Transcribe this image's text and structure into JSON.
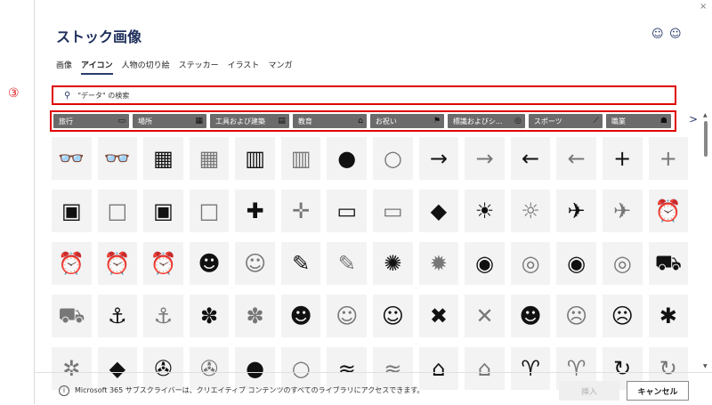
{
  "window": {
    "close_label": "×"
  },
  "header": {
    "title": "ストック画像",
    "smiley_1": "☺",
    "smiley_2": "☺"
  },
  "tabs": [
    "画像",
    "アイコン",
    "人物の切り絵",
    "ステッカー",
    "イラスト",
    "マンガ"
  ],
  "active_tab": "アイコン",
  "annotation_marker": "③",
  "search": {
    "text": "\"データ\" の検索",
    "icon": "search-icon"
  },
  "categories": [
    {
      "label": "旅行",
      "icon": "bus-icon"
    },
    {
      "label": "場所",
      "icon": "map-icon"
    },
    {
      "label": "工具および建築",
      "icon": "building-icon"
    },
    {
      "label": "教育",
      "icon": "school-icon"
    },
    {
      "label": "お祝い",
      "icon": "flag-icon"
    },
    {
      "label": "標識およびシ...",
      "icon": "sign-icon"
    },
    {
      "label": "スポーツ",
      "icon": "racket-icon"
    },
    {
      "label": "職業",
      "icon": "worker-icon"
    }
  ],
  "next_arrow": ">",
  "icon_grid": [
    [
      {
        "name": "3d-glasses",
        "glyph": "👓"
      },
      {
        "name": "3d-glasses-outline",
        "glyph": "👓"
      },
      {
        "name": "abacus",
        "glyph": "▦"
      },
      {
        "name": "abacus-outline",
        "glyph": "▦"
      },
      {
        "name": "abacus-alt",
        "glyph": "▥"
      },
      {
        "name": "abacus-alt-outline",
        "glyph": "▥"
      },
      {
        "name": "acorn",
        "glyph": "●"
      },
      {
        "name": "acorn-outline",
        "glyph": "○"
      },
      {
        "name": "arrow-right",
        "glyph": "→"
      },
      {
        "name": "arrow-right-outline",
        "glyph": "→"
      },
      {
        "name": "arrow-left",
        "glyph": "←"
      },
      {
        "name": "arrow-left-outline",
        "glyph": "←"
      },
      {
        "name": "plus",
        "glyph": "+"
      },
      {
        "name": "plus-outline",
        "glyph": "+"
      }
    ],
    [
      {
        "name": "address-book",
        "glyph": "▣"
      },
      {
        "name": "address-book-outline",
        "glyph": "□"
      },
      {
        "name": "address-book-alt",
        "glyph": "▣"
      },
      {
        "name": "address-book-alt-outline",
        "glyph": "□"
      },
      {
        "name": "bandage",
        "glyph": "✚"
      },
      {
        "name": "bandage-outline",
        "glyph": "✛"
      },
      {
        "name": "billboard",
        "glyph": "▭"
      },
      {
        "name": "billboard-outline",
        "glyph": "▭"
      },
      {
        "name": "africa",
        "glyph": "◆"
      },
      {
        "name": "agriculture",
        "glyph": "☀"
      },
      {
        "name": "agriculture-outline",
        "glyph": "☼"
      },
      {
        "name": "airplane",
        "glyph": "✈"
      },
      {
        "name": "airplane-outline",
        "glyph": "✈"
      },
      {
        "name": "alarm-clock",
        "glyph": "⏰"
      }
    ],
    [
      {
        "name": "alarm-clock-outline",
        "glyph": "⏰"
      },
      {
        "name": "alarm-ringing",
        "glyph": "⏰"
      },
      {
        "name": "alarm-ringing-outline",
        "glyph": "⏰"
      },
      {
        "name": "alien",
        "glyph": "☻"
      },
      {
        "name": "alien-outline",
        "glyph": "☺"
      },
      {
        "name": "needle",
        "glyph": "✎"
      },
      {
        "name": "needle-outline",
        "glyph": "✎"
      },
      {
        "name": "yarn",
        "glyph": "✺"
      },
      {
        "name": "yarn-outline",
        "glyph": "✹"
      },
      {
        "name": "tape-measure",
        "glyph": "◉"
      },
      {
        "name": "tape-measure-outline",
        "glyph": "◎"
      },
      {
        "name": "button",
        "glyph": "◉"
      },
      {
        "name": "button-outline",
        "glyph": "◎"
      },
      {
        "name": "ambulance",
        "glyph": "⛟"
      }
    ],
    [
      {
        "name": "ambulance-outline",
        "glyph": "⛟"
      },
      {
        "name": "anchor",
        "glyph": "⚓"
      },
      {
        "name": "anchor-outline",
        "glyph": "⚓"
      },
      {
        "name": "coral",
        "glyph": "✽"
      },
      {
        "name": "coral-outline",
        "glyph": "✽"
      },
      {
        "name": "angel-face",
        "glyph": "☻"
      },
      {
        "name": "angel-face-outline",
        "glyph": "☺"
      },
      {
        "name": "smile-face",
        "glyph": "☺"
      },
      {
        "name": "angry-mark",
        "glyph": "✖"
      },
      {
        "name": "angry-mark-outline",
        "glyph": "✕"
      },
      {
        "name": "angry-face",
        "glyph": "☻"
      },
      {
        "name": "angry-face-outline",
        "glyph": "☹"
      },
      {
        "name": "angry-face-alt",
        "glyph": "☹"
      },
      {
        "name": "ant",
        "glyph": "✱"
      }
    ],
    [
      {
        "name": "ant-outline",
        "glyph": "✲"
      },
      {
        "name": "antarctica",
        "glyph": "◆"
      },
      {
        "name": "aperture",
        "glyph": "✇"
      },
      {
        "name": "aperture-outline",
        "glyph": "✇"
      },
      {
        "name": "apple",
        "glyph": "●"
      },
      {
        "name": "apple-outline",
        "glyph": "○"
      },
      {
        "name": "aquarius",
        "glyph": "≈"
      },
      {
        "name": "aquarius-outline",
        "glyph": "≈"
      },
      {
        "name": "architecture",
        "glyph": "⌂"
      },
      {
        "name": "architecture-outline",
        "glyph": "⌂"
      },
      {
        "name": "aries",
        "glyph": "♈"
      },
      {
        "name": "aries-outline",
        "glyph": "♈"
      },
      {
        "name": "refresh",
        "glyph": "↻"
      },
      {
        "name": "refresh-outline",
        "glyph": "↻"
      }
    ]
  ],
  "footer": {
    "notice": "Microsoft 365 サブスクライバーは、クリエイティブ コンテンツのすべてのライブラリにアクセスできます。",
    "insert_label": "挿入",
    "cancel_label": "キャンセル"
  },
  "colors": {
    "title": "#1f2f5b",
    "highlight_box": "#e00000",
    "category_bg": "#6b6b6b"
  }
}
